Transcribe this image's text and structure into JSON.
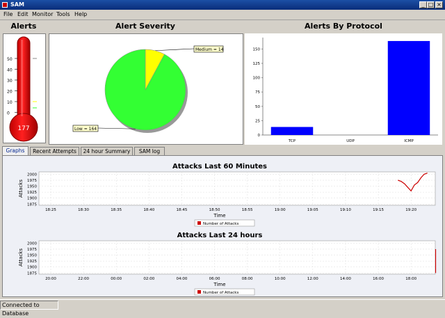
{
  "window": {
    "title": "SAM"
  },
  "menu": [
    "File",
    "Edit",
    "Monitor",
    "Tools",
    "Help"
  ],
  "alerts_panel": {
    "title": "Alerts",
    "value": "177",
    "ticks": [
      "50",
      "40",
      "30",
      "20",
      "10",
      "0"
    ]
  },
  "severity_chart": {
    "title": "Alert Severity",
    "slices": [
      {
        "label": "Medium = 14",
        "value": 14,
        "color": "#ffff00"
      },
      {
        "label": "Low = 164",
        "value": 164,
        "color": "#33ff33"
      }
    ]
  },
  "protocol_chart": {
    "title": "Alerts By Protocol",
    "y_ticks": [
      "150",
      "125",
      "100",
      "75",
      "50",
      "25",
      "0"
    ],
    "categories": [
      "TCP",
      "UDP",
      "ICMP"
    ],
    "values": [
      14,
      0,
      164
    ],
    "color": "#0000ff"
  },
  "tabs": [
    "Graphs",
    "Recent Attempts",
    "24 hour Summary",
    "SAM log"
  ],
  "chart_data": [
    {
      "type": "line",
      "title": "Attacks Last 60 Minutes",
      "xlabel": "Time",
      "ylabel": "Attacks",
      "x_ticks": [
        "18:25",
        "18:30",
        "18:35",
        "18:40",
        "18:45",
        "18:50",
        "18:55",
        "19:00",
        "19:05",
        "19:10",
        "19:15",
        "19:20"
      ],
      "y_ticks": [
        "2000",
        "1975",
        "1950",
        "1925",
        "1900",
        "1875"
      ],
      "ylim": [
        1870,
        2010
      ],
      "series": [
        {
          "name": "Number of Attacks",
          "color": "#cc0000",
          "x": [
            "19:18",
            "19:18.5",
            "19:19",
            "19:19.5",
            "19:20",
            "19:20.5",
            "19:21",
            "19:21.5",
            "19:22",
            "19:22.5"
          ],
          "values": [
            1975,
            1970,
            1960,
            1945,
            1930,
            1955,
            1965,
            1985,
            2000,
            2005
          ]
        }
      ]
    },
    {
      "type": "line",
      "title": "Attacks Last 24 hours",
      "xlabel": "Time",
      "ylabel": "Attacks",
      "x_ticks": [
        "20:00",
        "22:00",
        "00:00",
        "02:00",
        "04:00",
        "06:00",
        "08:00",
        "10:00",
        "12:00",
        "14:00",
        "16:00",
        "18:00"
      ],
      "y_ticks": [
        "2000",
        "1975",
        "1950",
        "1925",
        "1900",
        "1875"
      ],
      "ylim": [
        1870,
        2010
      ],
      "series": [
        {
          "name": "Number of Attacks",
          "color": "#cc0000",
          "x": [
            "19:30",
            "19:30"
          ],
          "values": [
            1975,
            1875
          ]
        }
      ]
    }
  ],
  "status": {
    "text": "Connected to Database"
  }
}
